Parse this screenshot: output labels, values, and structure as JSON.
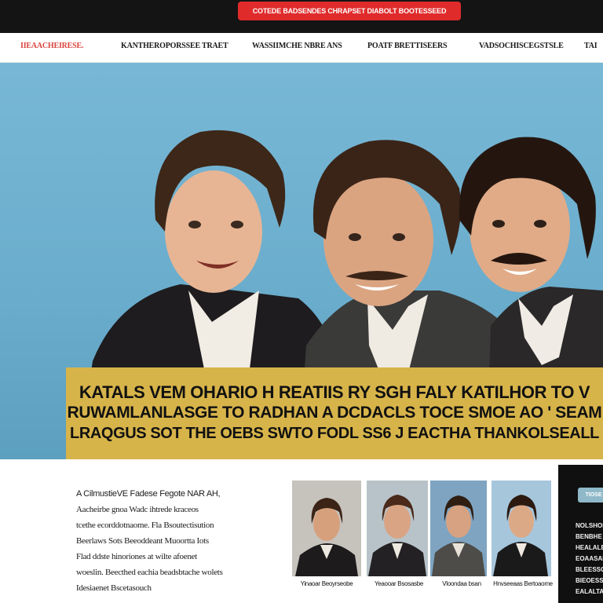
{
  "topbar": {
    "promo_label": "COTEDE BADSENDES CHRAPSET DIABOLT BOOTESSEED"
  },
  "nav": {
    "items": [
      {
        "label": "IIEAACHEIRESE."
      },
      {
        "label": "KANTHEROPORSSEE TRAET"
      },
      {
        "label": "WASSIIMCHE NBRE ANS"
      },
      {
        "label": "POATF BRETTISEERS"
      },
      {
        "label": "VADSOCHISCEGSTSLE"
      },
      {
        "label": "TAI"
      }
    ]
  },
  "hero": {
    "caption": {
      "line1": "KATALS VEM OHARIO H REATIIS RY SGH FALY KATILHOR TO V",
      "line2": "RUWAMLANLASGE TO RADHAN A DCDACLS TOCE SMOE AO ' SEAM",
      "line3": "LRAQGUS SOT THE OEBS SWTO FODL SS6 J EACTHA THANKOLSEALL"
    }
  },
  "article": {
    "lines": [
      "A CilmustieVE Fadese Fegote NAR AH,",
      "Aacheirbe gnoa Wadc ihtrede kraceos",
      "tcethe ecorddotnaome. Fla Bsoutectisution",
      "Beerlaws Sots Beeoddeant Muoortta Iots",
      "Flad ddste hinoriones at wilte afoenet",
      "woeslin. Beecthed eachia beadsbtache wolets",
      "Idesiaenet Bscetasouch"
    ]
  },
  "thumbnails": [
    {
      "caption": "Yinaoar Beoyrseobe"
    },
    {
      "caption": "Yeaooar Bsosasbe"
    },
    {
      "caption": "Vloondaa bsan"
    },
    {
      "caption": "Hnvseeaas Bertoaome"
    }
  ],
  "sidebar": {
    "button_label": "TIOSE",
    "lines": [
      "NOLSHORK",
      "BENBHE",
      "HEALALEBMIS",
      "EOAASAB",
      "BLEESSOE",
      "BIEOESSOR",
      "EALALTAE"
    ]
  },
  "colors": {
    "topbar_bg": "#141414",
    "promo_bg": "#e02b2b",
    "nav_active": "#d9443f",
    "hero_bg": "#6fb0cf",
    "caption_bg": "#d7b44a",
    "sidebar_bg": "#101010"
  }
}
